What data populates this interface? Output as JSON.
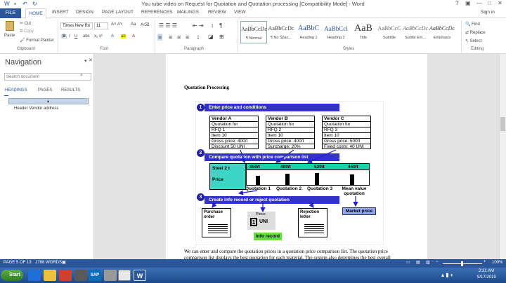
{
  "window": {
    "title": "You tube video on Request for Quotation and Quotation processing [Compatibility Mode] - Word",
    "sign_in": "Sign in"
  },
  "tabs": {
    "file": "FILE",
    "home": "HOME",
    "insert": "INSERT",
    "design": "DESIGN",
    "page_layout": "PAGE LAYOUT",
    "references": "REFERENCES",
    "mailings": "MAILINGS",
    "review": "REVIEW",
    "view": "VIEW"
  },
  "clipboard": {
    "paste": "Paste",
    "cut": "Cut",
    "copy": "Copy",
    "format_painter": "Format Painter",
    "label": "Clipboard"
  },
  "font": {
    "name": "Times New Ro",
    "size": "11",
    "label": "Font"
  },
  "paragraph": {
    "label": "Paragraph"
  },
  "styles": {
    "label": "Styles",
    "items": [
      {
        "sample": "AaBbCcDc",
        "name": "¶ Normal"
      },
      {
        "sample": "AaBbCcDc",
        "name": "¶ No Spac..."
      },
      {
        "sample": "AaBbC",
        "name": "Heading 1"
      },
      {
        "sample": "AaBbCcl",
        "name": "Heading 2"
      },
      {
        "sample": "AaB",
        "name": "Title"
      },
      {
        "sample": "AaBbCcC",
        "name": "Subtitle"
      },
      {
        "sample": "AaBbCcDc",
        "name": "Subtle Em..."
      },
      {
        "sample": "AaBbCcDc",
        "name": "Emphasis"
      }
    ]
  },
  "editing": {
    "find": "Find",
    "replace": "Replace",
    "select": "Select",
    "label": "Editing"
  },
  "navigation": {
    "title": "Navigation",
    "search_placeholder": "Search document",
    "tabs": [
      "HEADINGS",
      "PAGES",
      "RESULTS"
    ],
    "item": "Header  Vendor address"
  },
  "document": {
    "heading": "Quotation Processing",
    "body_line1": "We can enter and compare the quotation prices in a quotation price comparison list. The quotation price",
    "body_line2": "comparison list displays the best quotation for each material. The system also determines the best overall"
  },
  "diagram": {
    "step1": {
      "num": "1",
      "label": "Enter price and conditions"
    },
    "step2": {
      "num": "2",
      "label": "Compare quotation with price comparison list"
    },
    "step3": {
      "num": "3",
      "label": "Create info record or reject quotation"
    },
    "vendors": [
      {
        "rows": [
          "Vendor A",
          "Quotation for",
          "RFQ 1",
          "Item 10",
          "Gross price: 400/t",
          "Discount       50 UNI"
        ]
      },
      {
        "rows": [
          "Vendor B",
          "Quotation for",
          "RFQ 2",
          "Item 10",
          "Gross price: 400/t",
          "Surcharge:   20%"
        ]
      },
      {
        "rows": [
          "Vendor C",
          "Quotation for",
          "RFQ 3",
          "Item 10",
          "Gross price: 500/t",
          "Fixed costs: 40 UNI"
        ]
      }
    ],
    "comparison": {
      "row_label_1": "Steel 2 t",
      "row_label_2": "Price",
      "prices": [
        "350/t",
        "480/t",
        "520/t",
        "450/t"
      ],
      "columns": [
        "Quotation 1",
        "Quotation 2",
        "Quotation 3",
        "Mean value quotation"
      ]
    },
    "market_price": "Market price",
    "purchase_order": "Purchase order",
    "piece": "Piece",
    "piece_val": "1",
    "piece_unit": "UNI",
    "info_record": "Info record",
    "rejection_letter": "Rejection letter"
  },
  "status": {
    "page": "PAGE 5 OF 13",
    "words": "1786 WORDS",
    "zoom": "100%"
  },
  "taskbar": {
    "start": "Start",
    "time": "2:31 AM",
    "date": "9/17/2019"
  }
}
